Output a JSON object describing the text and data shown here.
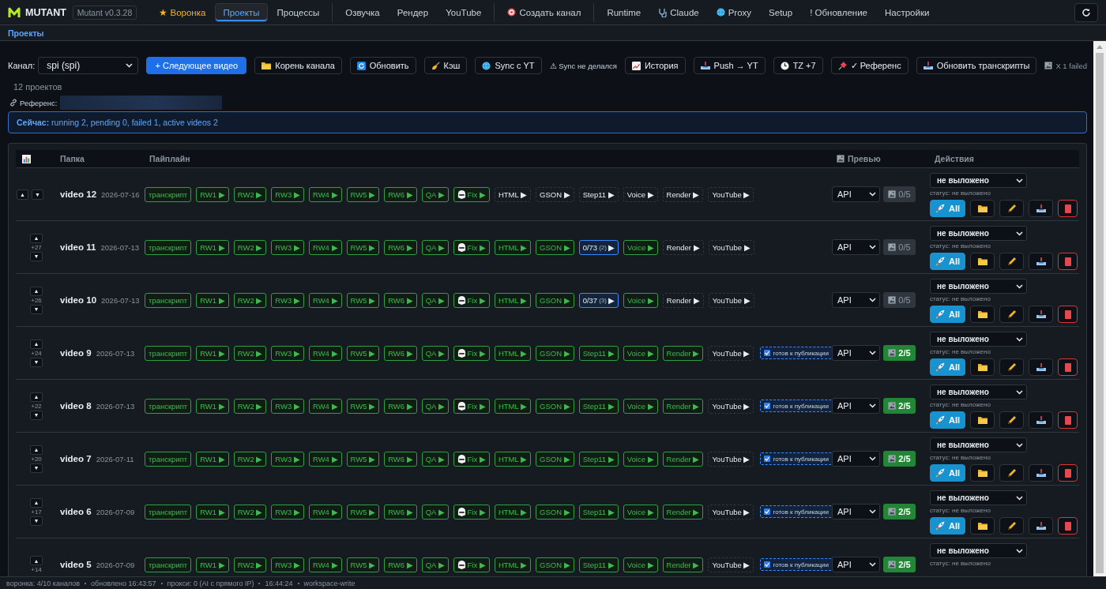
{
  "nav": {
    "brand": "MUTANT",
    "version": "Mutant v0.3.28",
    "groups": [
      [
        {
          "label": "★ Воронка",
          "kind": "featured",
          "selected": false
        },
        {
          "label": "Проекты",
          "kind": "plain",
          "selected": true
        },
        {
          "label": "Процессы",
          "kind": "plain",
          "selected": false
        }
      ],
      [
        {
          "label": "Озвучка",
          "kind": "plain",
          "selected": false
        },
        {
          "label": "Рендер",
          "kind": "plain",
          "selected": false
        },
        {
          "label": "YouTube",
          "kind": "plain",
          "selected": false
        }
      ],
      [
        {
          "label": "Создать канал",
          "kind": "plain",
          "selected": false
        }
      ],
      [
        {
          "label": "Runtime",
          "kind": "plain",
          "selected": false
        },
        {
          "label": "Claude",
          "kind": "plain",
          "selected": false
        },
        {
          "label": "Proxy",
          "kind": "plain",
          "selected": false
        },
        {
          "label": "Setup",
          "kind": "plain",
          "selected": false
        },
        {
          "label": "! Обновление",
          "kind": "plain",
          "selected": false
        },
        {
          "label": "Настройки",
          "kind": "plain",
          "selected": false
        }
      ]
    ]
  },
  "breadcrumb": "Проекты",
  "toolbar": {
    "channel_label": "Канал:",
    "channel": "spi (spi)",
    "buttons": [
      {
        "label": "+ Следующее видео",
        "kind": "primary"
      },
      {
        "label": "Корень канала",
        "kind": "default"
      },
      {
        "label": "Обновить",
        "kind": "default"
      },
      {
        "label": "Кэш",
        "kind": "default"
      },
      {
        "label": "Sync с YT",
        "kind": "default"
      },
      {
        "label": "⚠ Sync не делался",
        "kind": "note"
      },
      {
        "label": "История",
        "kind": "default"
      },
      {
        "label": "Push → YT",
        "kind": "default"
      },
      {
        "label": "TZ +7",
        "kind": "default"
      },
      {
        "label": "✓ Референс",
        "kind": "default"
      },
      {
        "label": "Обновить транскрипты",
        "kind": "default"
      }
    ],
    "failed": "X 1 failed"
  },
  "project_count": "12 проектов",
  "reference_label": "Референс:",
  "now_status": "**Сейчас:** running 2, pending 0, failed 1, active videos 2",
  "table": {
    "columns": [
      "Папка",
      "Пайплайн",
      "Превью",
      "Действия"
    ],
    "rows": [
      {
        "up": "▲",
        "down": "▼",
        "name": "video 12",
        "date": "2026-07-16",
        "steps": [
          {
            "label": "транскрипт",
            "kind": "done"
          },
          {
            "label": "RW1 ▶",
            "kind": "done"
          },
          {
            "label": "RW2 ▶",
            "kind": "done"
          },
          {
            "label": "RW3 ▶",
            "kind": "done"
          },
          {
            "label": "RW4 ▶",
            "kind": "done"
          },
          {
            "label": "RW5 ▶",
            "kind": "done"
          },
          {
            "label": "RW6 ▶",
            "kind": "done"
          },
          {
            "label": "QA ▶",
            "kind": "done"
          },
          {
            "label": "Fix ▶",
            "kind": "done"
          },
          {
            "label": "HTML ▶",
            "kind": "pending"
          },
          {
            "label": "GSON ▶",
            "kind": "pending"
          },
          {
            "label": "Step11 ▶",
            "kind": "pending"
          },
          {
            "label": "Voice ▶",
            "kind": "pending"
          },
          {
            "label": "Render ▶",
            "kind": "pending"
          },
          {
            "label": "YouTube ▶",
            "kind": "pending"
          }
        ],
        "preview_mode": "API",
        "preview_count": "0/5",
        "preview_ready": false,
        "publish_state": "не выложено",
        "status_text": "статус: не выложено",
        "all_label": "All"
      },
      {
        "up": "▲",
        "rank": "+27",
        "down": "▼",
        "name": "video 11",
        "date": "2026-07-13",
        "steps": [
          {
            "label": "транскрипт",
            "kind": "done"
          },
          {
            "label": "RW1 ▶",
            "kind": "done"
          },
          {
            "label": "RW2 ▶",
            "kind": "done"
          },
          {
            "label": "RW3 ▶",
            "kind": "done"
          },
          {
            "label": "RW4 ▶",
            "kind": "done"
          },
          {
            "label": "RW5 ▶",
            "kind": "done"
          },
          {
            "label": "RW6 ▶",
            "kind": "done"
          },
          {
            "label": "QA ▶",
            "kind": "done"
          },
          {
            "label": "Fix ▶",
            "kind": "done"
          },
          {
            "label": "HTML ▶",
            "kind": "done"
          },
          {
            "label": "GSON ▶",
            "kind": "done"
          },
          {
            "label": "0/73",
            "count": "(2)",
            "arrow": "▶",
            "kind": "progress"
          },
          {
            "label": "Voice ▶",
            "kind": "done"
          },
          {
            "label": "Render ▶",
            "kind": "pending"
          },
          {
            "label": "YouTube ▶",
            "kind": "pending"
          }
        ],
        "preview_mode": "API",
        "preview_count": "0/5",
        "preview_ready": false,
        "publish_state": "не выложено",
        "status_text": "статус: не выложено",
        "all_label": "All"
      },
      {
        "up": "▲",
        "rank": "+26",
        "down": "▼",
        "name": "video 10",
        "date": "2026-07-13",
        "steps": [
          {
            "label": "транскрипт",
            "kind": "done"
          },
          {
            "label": "RW1 ▶",
            "kind": "done"
          },
          {
            "label": "RW2 ▶",
            "kind": "done"
          },
          {
            "label": "RW3 ▶",
            "kind": "done"
          },
          {
            "label": "RW4 ▶",
            "kind": "done"
          },
          {
            "label": "RW5 ▶",
            "kind": "done"
          },
          {
            "label": "RW6 ▶",
            "kind": "done"
          },
          {
            "label": "QA ▶",
            "kind": "done"
          },
          {
            "label": "Fix ▶",
            "kind": "done"
          },
          {
            "label": "HTML ▶",
            "kind": "done"
          },
          {
            "label": "GSON ▶",
            "kind": "done"
          },
          {
            "label": "0/37",
            "count": "(3)",
            "arrow": "▶",
            "kind": "progress"
          },
          {
            "label": "Voice ▶",
            "kind": "done"
          },
          {
            "label": "Render ▶",
            "kind": "pending"
          },
          {
            "label": "YouTube ▶",
            "kind": "pending"
          }
        ],
        "preview_mode": "API",
        "preview_count": "0/5",
        "preview_ready": false,
        "publish_state": "не выложено",
        "status_text": "статус: не выложено",
        "all_label": "All"
      },
      {
        "up": "▲",
        "rank": "+24",
        "down": "▼",
        "name": "video 9",
        "date": "2026-07-13",
        "steps": [
          {
            "label": "транскрипт",
            "kind": "done"
          },
          {
            "label": "RW1 ▶",
            "kind": "done"
          },
          {
            "label": "RW2 ▶",
            "kind": "done"
          },
          {
            "label": "RW3 ▶",
            "kind": "done"
          },
          {
            "label": "RW4 ▶",
            "kind": "done"
          },
          {
            "label": "RW5 ▶",
            "kind": "done"
          },
          {
            "label": "RW6 ▶",
            "kind": "done"
          },
          {
            "label": "QA ▶",
            "kind": "done"
          },
          {
            "label": "Fix ▶",
            "kind": "done"
          },
          {
            "label": "HTML ▶",
            "kind": "done"
          },
          {
            "label": "GSON ▶",
            "kind": "done"
          },
          {
            "label": "Step11 ▶",
            "kind": "done"
          },
          {
            "label": "Voice ▶",
            "kind": "done"
          },
          {
            "label": "Render ▶",
            "kind": "done"
          },
          {
            "label": "YouTube ▶",
            "kind": "pending"
          }
        ],
        "publish_badge": "готов к публикации",
        "preview_mode": "API",
        "preview_count": "2/5",
        "preview_ready": true,
        "publish_state": "не выложено",
        "status_text": "статус: не выложено",
        "all_label": "All"
      },
      {
        "up": "▲",
        "rank": "+22",
        "down": "▼",
        "name": "video 8",
        "date": "2026-07-13",
        "steps": [
          {
            "label": "транскрипт",
            "kind": "done"
          },
          {
            "label": "RW1 ▶",
            "kind": "done"
          },
          {
            "label": "RW2 ▶",
            "kind": "done"
          },
          {
            "label": "RW3 ▶",
            "kind": "done"
          },
          {
            "label": "RW4 ▶",
            "kind": "done"
          },
          {
            "label": "RW5 ▶",
            "kind": "done"
          },
          {
            "label": "RW6 ▶",
            "kind": "done"
          },
          {
            "label": "QA ▶",
            "kind": "done"
          },
          {
            "label": "Fix ▶",
            "kind": "done"
          },
          {
            "label": "HTML ▶",
            "kind": "done"
          },
          {
            "label": "GSON ▶",
            "kind": "done"
          },
          {
            "label": "Step11 ▶",
            "kind": "done"
          },
          {
            "label": "Voice ▶",
            "kind": "done"
          },
          {
            "label": "Render ▶",
            "kind": "done"
          },
          {
            "label": "YouTube ▶",
            "kind": "pending"
          }
        ],
        "publish_badge": "готов к публикации",
        "preview_mode": "API",
        "preview_count": "2/5",
        "preview_ready": true,
        "publish_state": "не выложено",
        "status_text": "статус: не выложено",
        "all_label": "All"
      },
      {
        "up": "▲",
        "rank": "+20",
        "down": "▼",
        "name": "video 7",
        "date": "2026-07-11",
        "steps": [
          {
            "label": "транскрипт",
            "kind": "done"
          },
          {
            "label": "RW1 ▶",
            "kind": "done"
          },
          {
            "label": "RW2 ▶",
            "kind": "done"
          },
          {
            "label": "RW3 ▶",
            "kind": "done"
          },
          {
            "label": "RW4 ▶",
            "kind": "done"
          },
          {
            "label": "RW5 ▶",
            "kind": "done"
          },
          {
            "label": "RW6 ▶",
            "kind": "done"
          },
          {
            "label": "QA ▶",
            "kind": "done"
          },
          {
            "label": "Fix ▶",
            "kind": "done"
          },
          {
            "label": "HTML ▶",
            "kind": "done"
          },
          {
            "label": "GSON ▶",
            "kind": "done"
          },
          {
            "label": "Step11 ▶",
            "kind": "done"
          },
          {
            "label": "Voice ▶",
            "kind": "done"
          },
          {
            "label": "Render ▶",
            "kind": "done"
          },
          {
            "label": "YouTube ▶",
            "kind": "pending"
          }
        ],
        "publish_badge": "готов к публикации",
        "preview_mode": "API",
        "preview_count": "2/5",
        "preview_ready": true,
        "publish_state": "не выложено",
        "status_text": "статус: не выложено",
        "all_label": "All"
      },
      {
        "up": "▲",
        "rank": "+17",
        "down": "▼",
        "name": "video 6",
        "date": "2026-07-09",
        "steps": [
          {
            "label": "транскрипт",
            "kind": "done"
          },
          {
            "label": "RW1 ▶",
            "kind": "done"
          },
          {
            "label": "RW2 ▶",
            "kind": "done"
          },
          {
            "label": "RW3 ▶",
            "kind": "done"
          },
          {
            "label": "RW4 ▶",
            "kind": "done"
          },
          {
            "label": "RW5 ▶",
            "kind": "done"
          },
          {
            "label": "RW6 ▶",
            "kind": "done"
          },
          {
            "label": "QA ▶",
            "kind": "done"
          },
          {
            "label": "Fix ▶",
            "kind": "done"
          },
          {
            "label": "HTML ▶",
            "kind": "done"
          },
          {
            "label": "GSON ▶",
            "kind": "done"
          },
          {
            "label": "Step11 ▶",
            "kind": "done"
          },
          {
            "label": "Voice ▶",
            "kind": "done"
          },
          {
            "label": "Render ▶",
            "kind": "done"
          },
          {
            "label": "YouTube ▶",
            "kind": "pending"
          }
        ],
        "publish_badge": "готов к публикации",
        "preview_mode": "API",
        "preview_count": "2/5",
        "preview_ready": true,
        "publish_state": "не выложено",
        "status_text": "статус: не выложено",
        "all_label": "All"
      },
      {
        "up": "▲",
        "rank": "+14",
        "name": "video 5",
        "date": "2026-07-09",
        "steps": [
          {
            "label": "транскрипт",
            "kind": "done"
          },
          {
            "label": "RW1 ▶",
            "kind": "done"
          },
          {
            "label": "RW2 ▶",
            "kind": "done"
          },
          {
            "label": "RW3 ▶",
            "kind": "done"
          },
          {
            "label": "RW4 ▶",
            "kind": "done"
          },
          {
            "label": "RW5 ▶",
            "kind": "done"
          },
          {
            "label": "RW6 ▶",
            "kind": "done"
          },
          {
            "label": "QA ▶",
            "kind": "done"
          },
          {
            "label": "Fix ▶",
            "kind": "done"
          },
          {
            "label": "HTML ▶",
            "kind": "done"
          },
          {
            "label": "GSON ▶",
            "kind": "done"
          },
          {
            "label": "Step11 ▶",
            "kind": "done"
          },
          {
            "label": "Voice ▶",
            "kind": "done"
          },
          {
            "label": "Render ▶",
            "kind": "done"
          },
          {
            "label": "YouTube ▶",
            "kind": "pending"
          }
        ],
        "publish_badge": "готов к публикации",
        "preview_mode": "API",
        "preview_count": "2/5",
        "preview_ready": true,
        "publish_state": "не выложено",
        "status_text": "статус: не выложено"
      }
    ]
  },
  "status_bar": [
    "воронка: 4/10 каналов",
    "обновлено 16:43:57",
    "прокси: 0 (AI с прямого IP)",
    "16:44:24",
    "workspace-write"
  ]
}
